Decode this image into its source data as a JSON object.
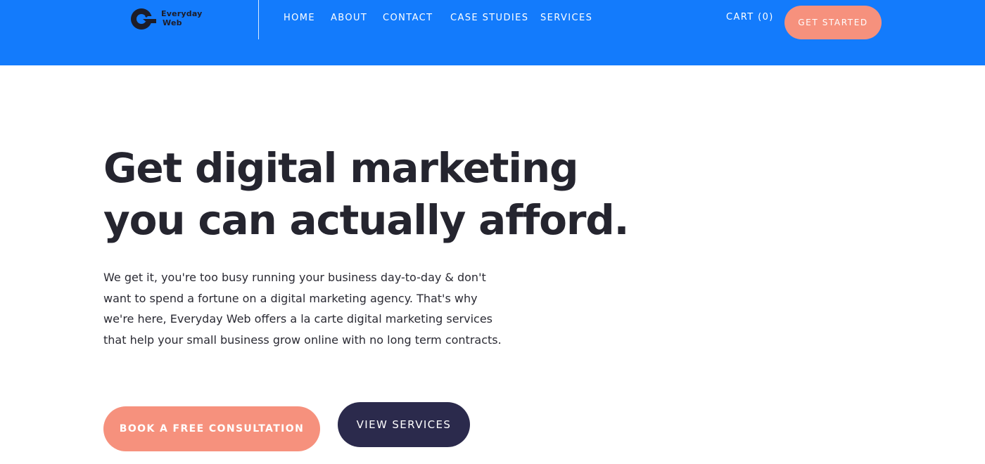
{
  "header": {
    "logo": {
      "line1": "Everyday",
      "line2": "Web",
      "icon": "everyday-web-logo-icon"
    },
    "nav": [
      {
        "label": "HOME"
      },
      {
        "label": "ABOUT"
      },
      {
        "label": "CONTACT"
      },
      {
        "label": "CASE STUDIES"
      },
      {
        "label": "SERVICES"
      }
    ],
    "cart_label": "CART (0)",
    "cta_label": "GET STARTED"
  },
  "hero": {
    "title_line1": "Get digital marketing",
    "title_line2": "you can actually afford.",
    "body": "We get it, you're too busy running your business day-to-day & don't want to spend a fortune on a digital marketing agency. That's why we're here, Everyday Web offers a la carte digital marketing services that help your small business grow online with no long term contracts.",
    "primary_button": "BOOK A FREE CONSULTATION",
    "secondary_button": "VIEW SERVICES"
  },
  "colors": {
    "header_bg": "#137bfc",
    "accent_salmon": "#f6917d",
    "dark_navy": "#2b2a4c",
    "heading_text": "#25252f"
  }
}
